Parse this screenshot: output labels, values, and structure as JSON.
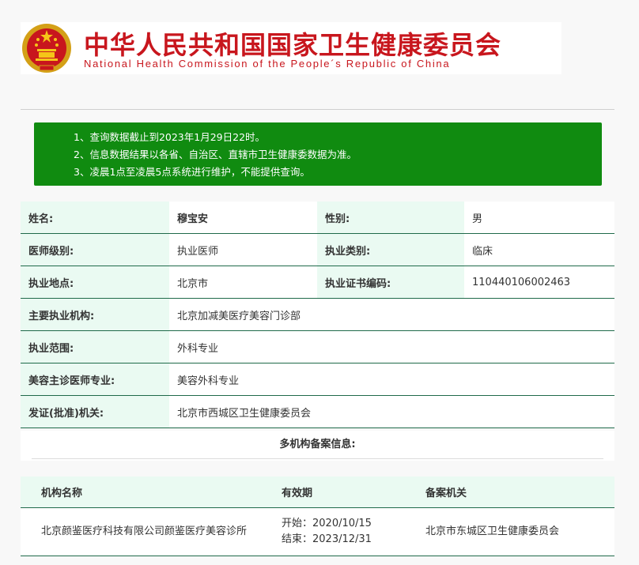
{
  "header": {
    "title_cn": "中华人民共和国国家卫生健康委员会",
    "title_en": "National Health Commission of the People´s Republic of China",
    "emblem_icon": "national-emblem-icon"
  },
  "notice": {
    "items": [
      "1、查询数据截止到2023年1月29日22时。",
      "2、信息数据结果以各省、自治区、直辖市卫生健康委数据为准。",
      "3、凌晨1点至凌晨5点系统进行维护，不能提供查询。"
    ],
    "bg_color": "#108b10"
  },
  "info": {
    "name_label": "姓名:",
    "name_value": "穆宝安",
    "gender_label": "性别:",
    "gender_value": "男",
    "level_label": "医师级别:",
    "level_value": "执业医师",
    "category_label": "执业类别:",
    "category_value": "临床",
    "location_label": "执业地点:",
    "location_value": "北京市",
    "cert_label": "执业证书编码:",
    "cert_value": "110440106002463",
    "org_label": "主要执业机构:",
    "org_value": "北京加减美医疗美容门诊部",
    "scope_label": "执业范围:",
    "scope_value": "外科专业",
    "cosmetic_label": "美容主诊医师专业:",
    "cosmetic_value": "美容外科专业",
    "issuer_label": "发证(批准)机关:",
    "issuer_value": "北京市西城区卫生健康委员会"
  },
  "multi": {
    "title": "多机构备案信息:",
    "headers": [
      "机构名称",
      "有效期",
      "备案机关"
    ],
    "rows": [
      {
        "org": "北京颜鉴医疗科技有限公司颜鉴医疗美容诊所",
        "start": "开始：2020/10/15",
        "end": "结束：2023/12/31",
        "authority": "北京市东城区卫生健康委员会"
      }
    ]
  }
}
